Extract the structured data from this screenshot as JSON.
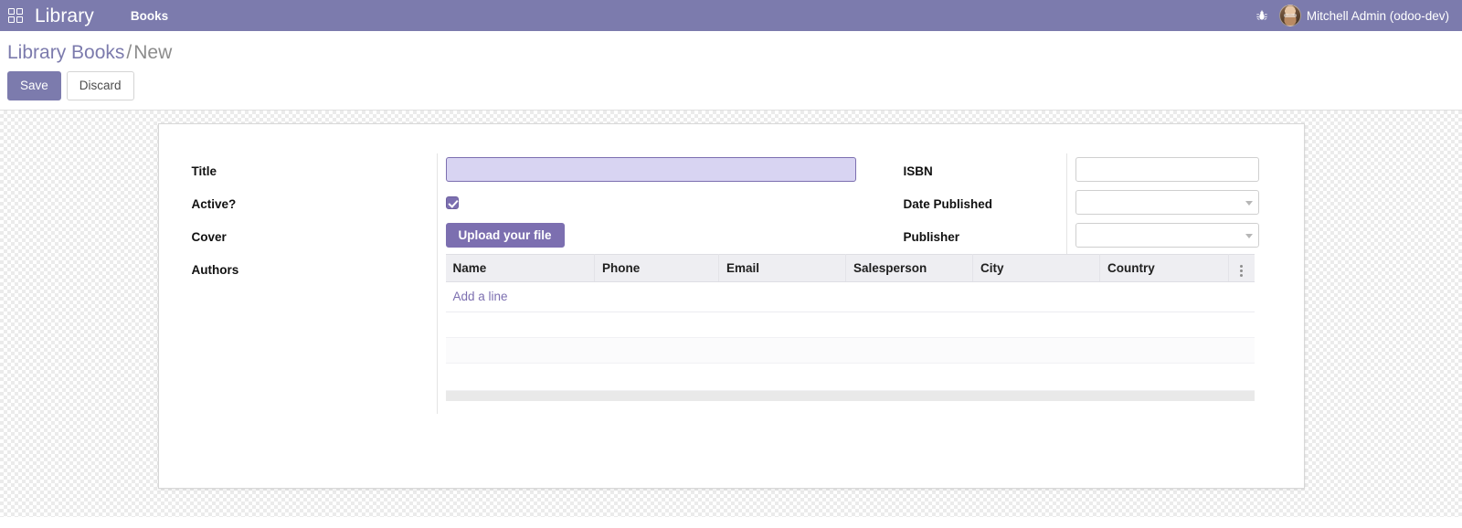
{
  "navbar": {
    "apps_icon": "apps-grid-icon",
    "brand": "Library",
    "menu_items": [
      {
        "label": "Books"
      }
    ],
    "debug_icon": "bug-icon",
    "debug_glyph": "⚙",
    "user_name": "Mitchell Admin (odoo-dev)",
    "bg_color": "#7c7bad"
  },
  "control_panel": {
    "breadcrumb": {
      "root": "Library Books",
      "separator": "/",
      "current": "New"
    },
    "buttons": {
      "save": "Save",
      "discard": "Discard"
    },
    "accent_color": "#7c7bad"
  },
  "form": {
    "left": {
      "labels": {
        "title": "Title",
        "active": "Active?",
        "cover": "Cover",
        "authors": "Authors"
      },
      "title_value": "",
      "title_placeholder": "",
      "active_checked": true,
      "cover_upload_label": "Upload your file"
    },
    "right": {
      "labels": {
        "isbn": "ISBN",
        "date_published": "Date Published",
        "publisher": "Publisher"
      },
      "isbn_value": "",
      "isbn_placeholder": "",
      "date_published_value": "",
      "date_published_placeholder": "",
      "publisher_value": "",
      "publisher_placeholder": ""
    },
    "authors_table": {
      "columns": [
        "Name",
        "Phone",
        "Email",
        "Salesperson",
        "City",
        "Country"
      ],
      "optional_columns_icon": "kebab-vertical-icon",
      "add_line_label": "Add a line",
      "rows": []
    },
    "required_field_bg": "#d8d4f2",
    "required_field_border": "#7c6fb0"
  }
}
